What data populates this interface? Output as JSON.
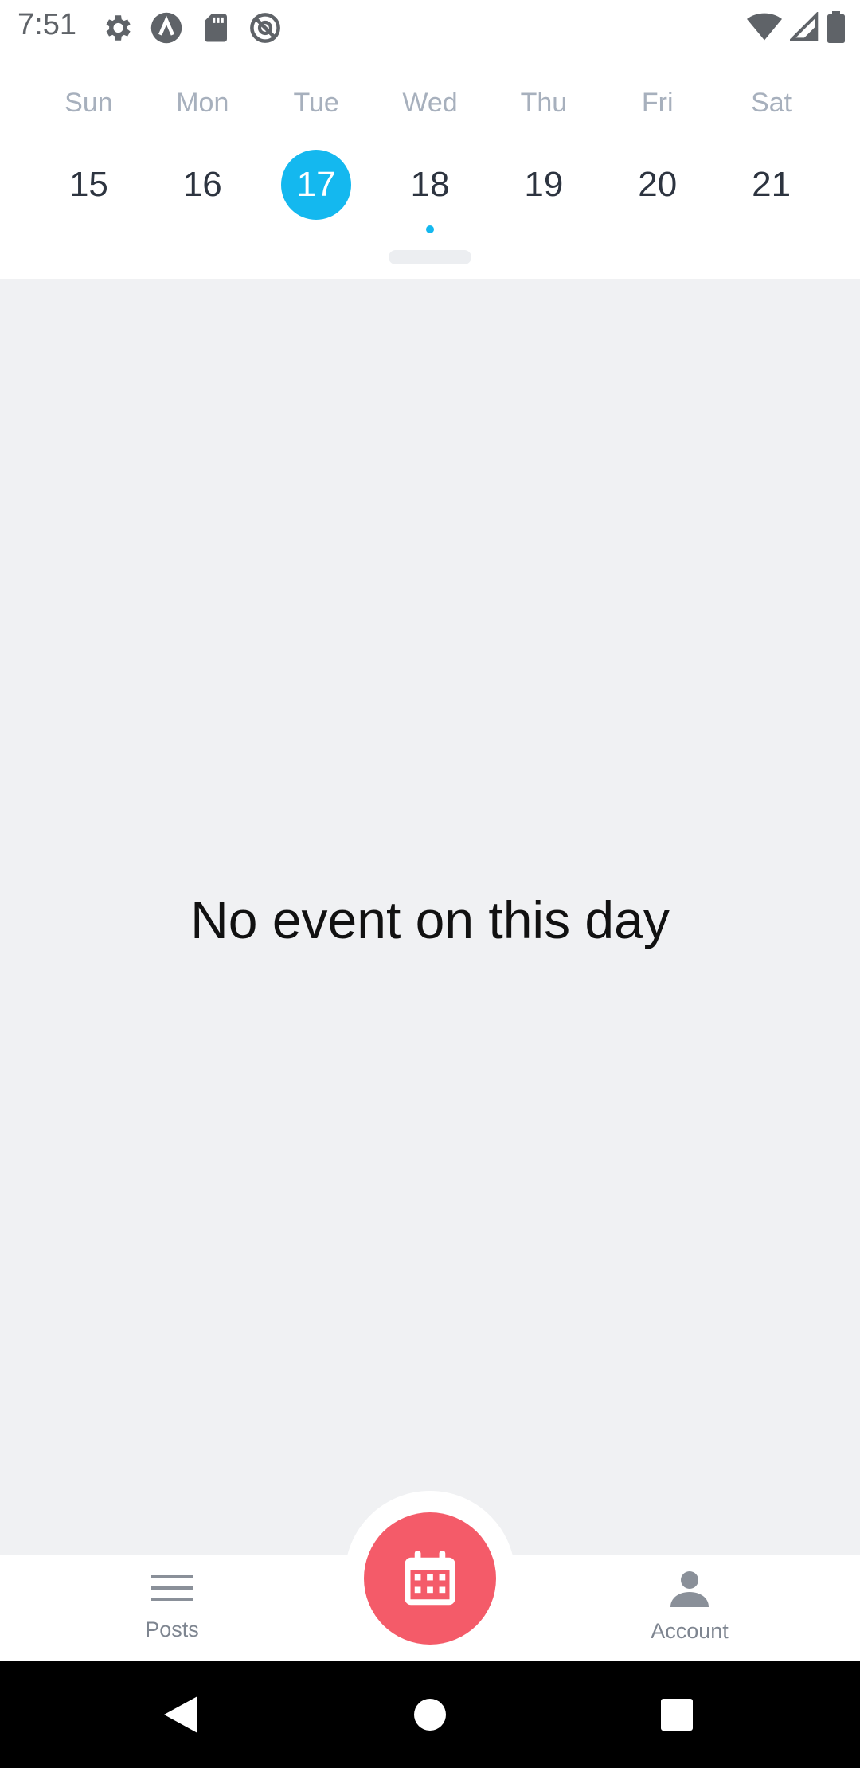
{
  "status_bar": {
    "time": "7:51",
    "left_icons": [
      "gear-icon",
      "app-a-icon",
      "sd-card-icon",
      "no-location-icon"
    ],
    "right_icons": [
      "wifi-icon",
      "signal-icon",
      "battery-icon"
    ]
  },
  "calendar": {
    "weekdays": [
      "Sun",
      "Mon",
      "Tue",
      "Wed",
      "Thu",
      "Fri",
      "Sat"
    ],
    "dates": [
      "15",
      "16",
      "17",
      "18",
      "19",
      "20",
      "21"
    ],
    "selected_date": "17",
    "event_dot_date": "18",
    "accent_color": "#14b8ef"
  },
  "main": {
    "empty_message": "No event on this day"
  },
  "bottom_nav": {
    "posts_label": "Posts",
    "account_label": "Account",
    "fab_icon": "calendar-icon",
    "fab_color": "#f45b69"
  },
  "system_nav": {
    "buttons": [
      "back-icon",
      "home-icon",
      "recents-icon"
    ]
  }
}
